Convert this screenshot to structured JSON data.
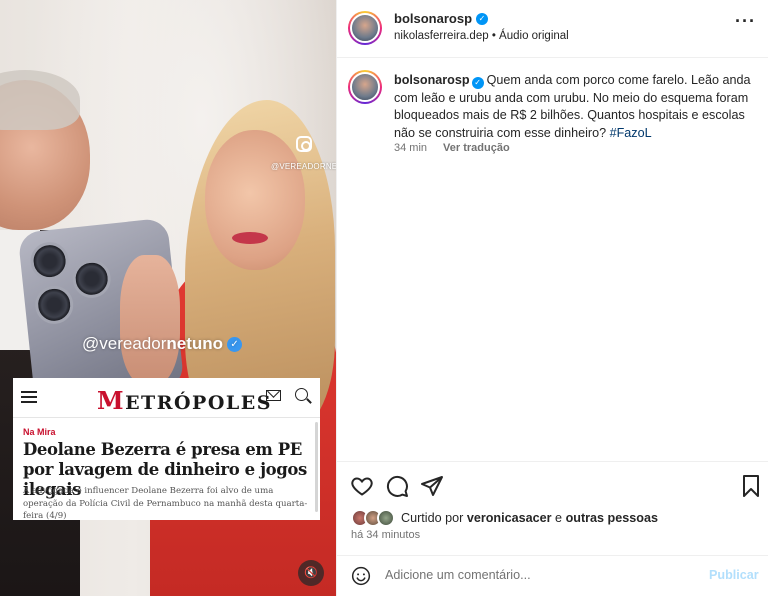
{
  "media": {
    "small_watermark": "@VEREADORNETUNO",
    "overlay_handle_prefix": "@vereador",
    "overlay_handle_bold": "netuno",
    "news": {
      "logo_first": "M",
      "logo_rest": "ETRÓPOLES",
      "tag": "Na Mira",
      "title": "Deolane Bezerra é presa em PE por lavagem de dinheiro e jogos ilegais",
      "body": "A advogada e influencer Deolane Bezerra foi alvo de uma operação da Polícia Civil de Pernambuco na manhã desta quarta-feira (4/9)"
    }
  },
  "header": {
    "username": "bolsonarosp",
    "collab": "nikolasferreira.dep",
    "separator": "•",
    "audio": "Áudio original"
  },
  "caption": {
    "username": "bolsonarosp",
    "text": "Quem anda com porco come farelo. Leão anda com leão e urubu anda com urubu. No meio do esquema foram bloqueados mais de R$ 2 bilhões. Quantos hospitais e escolas não se construiria com esse dinheiro?",
    "hashtag": "#FazoL",
    "time": "34 min",
    "translate": "Ver tradução"
  },
  "likes": {
    "prefix": "Curtido por",
    "user": "veronicasacer",
    "conj": "e",
    "others": "outras pessoas"
  },
  "post_time": "há 34 minutos",
  "comment": {
    "placeholder": "Adicione um comentário...",
    "publish": "Publicar"
  },
  "colors": {
    "verified": "#0095f6",
    "link": "#00376b",
    "publish_disabled": "#b2dffc",
    "metropoles_red": "#c8102e"
  },
  "icons": [
    "instagram-icon",
    "verified-icon",
    "more-icon",
    "heart-icon",
    "comment-icon",
    "share-icon",
    "bookmark-icon",
    "emoji-icon",
    "mute-icon",
    "menu-icon",
    "mail-icon",
    "search-icon"
  ]
}
